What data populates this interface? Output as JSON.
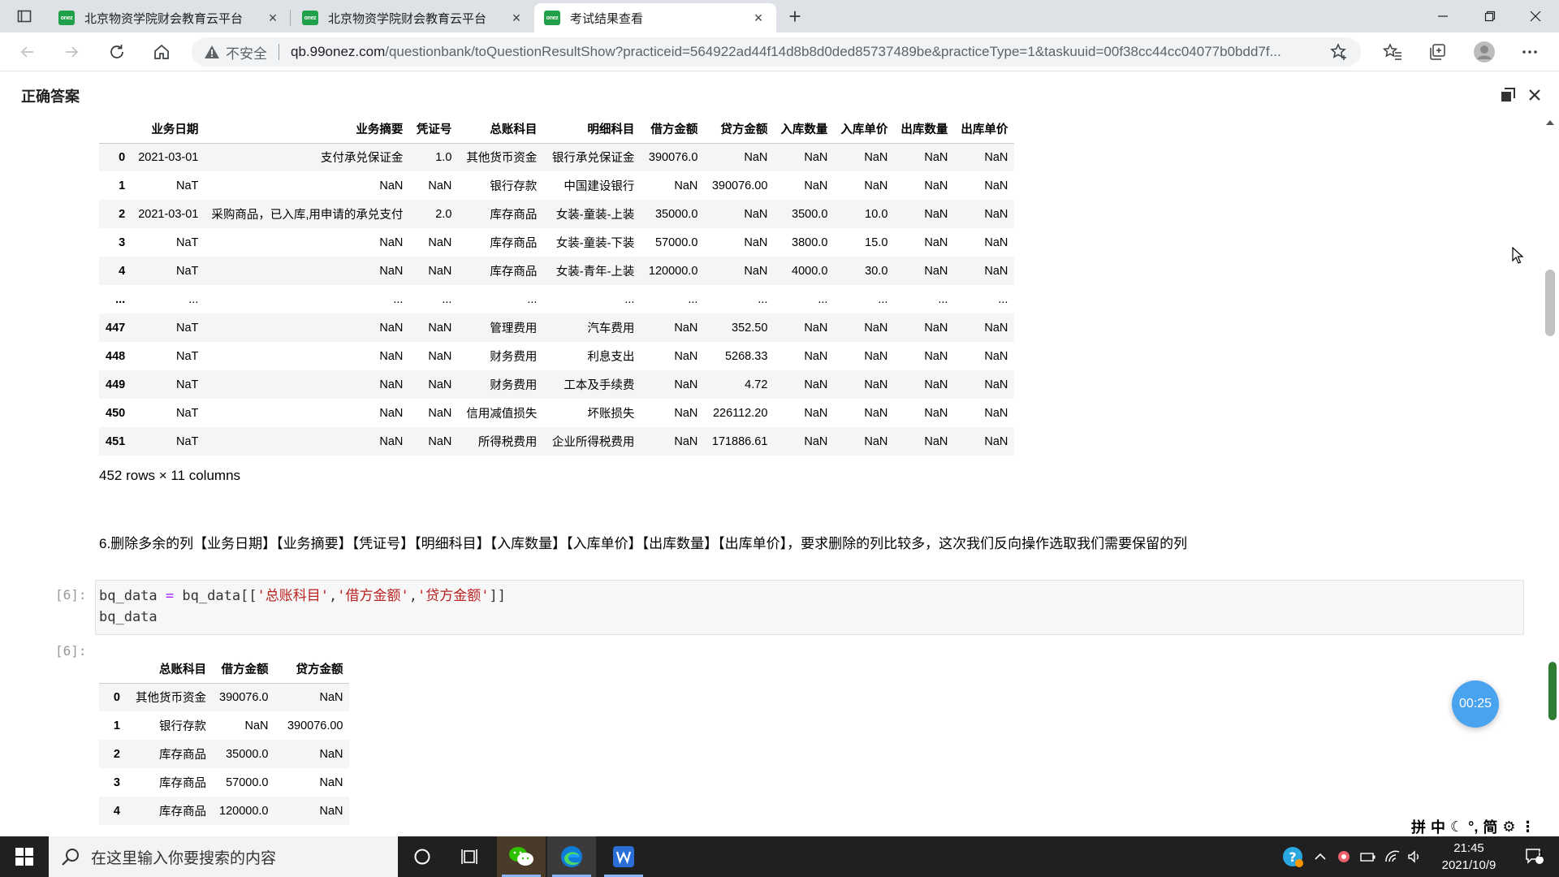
{
  "browser": {
    "tabs": [
      {
        "title": "北京物资学院财会教育云平台",
        "favicon_text": "onez"
      },
      {
        "title": "北京物资学院财会教育云平台",
        "favicon_text": "onez"
      },
      {
        "title": "考试结果查看",
        "favicon_text": "onez"
      }
    ],
    "address": {
      "security_label": "不安全",
      "host": "qb.99onez.com",
      "path": "/questionbank/toQuestionResultShow?practiceid=564922ad44f14d8b8d0ded85737489be&practiceType=1&taskuuid=00f38cc44cc04077b0bdd7f..."
    }
  },
  "panel": {
    "title": "正确答案"
  },
  "table1": {
    "columns": [
      "",
      "业务日期",
      "业务摘要",
      "凭证号",
      "总账科目",
      "明细科目",
      "借方金额",
      "贷方金额",
      "入库数量",
      "入库单价",
      "出库数量",
      "出库单价"
    ],
    "rows": [
      [
        "0",
        "2021-03-01",
        "支付承兑保证金",
        "1.0",
        "其他货币资金",
        "银行承兑保证金",
        "390076.0",
        "NaN",
        "NaN",
        "NaN",
        "NaN",
        "NaN"
      ],
      [
        "1",
        "NaT",
        "NaN",
        "NaN",
        "银行存款",
        "中国建设银行",
        "NaN",
        "390076.00",
        "NaN",
        "NaN",
        "NaN",
        "NaN"
      ],
      [
        "2",
        "2021-03-01",
        "采购商品，已入库,用申请的承兑支付",
        "2.0",
        "库存商品",
        "女装-童装-上装",
        "35000.0",
        "NaN",
        "3500.0",
        "10.0",
        "NaN",
        "NaN"
      ],
      [
        "3",
        "NaT",
        "NaN",
        "NaN",
        "库存商品",
        "女装-童装-下装",
        "57000.0",
        "NaN",
        "3800.0",
        "15.0",
        "NaN",
        "NaN"
      ],
      [
        "4",
        "NaT",
        "NaN",
        "NaN",
        "库存商品",
        "女装-青年-上装",
        "120000.0",
        "NaN",
        "4000.0",
        "30.0",
        "NaN",
        "NaN"
      ],
      [
        "...",
        "...",
        "...",
        "...",
        "...",
        "...",
        "...",
        "...",
        "...",
        "...",
        "...",
        "..."
      ],
      [
        "447",
        "NaT",
        "NaN",
        "NaN",
        "管理费用",
        "汽车费用",
        "NaN",
        "352.50",
        "NaN",
        "NaN",
        "NaN",
        "NaN"
      ],
      [
        "448",
        "NaT",
        "NaN",
        "NaN",
        "财务费用",
        "利息支出",
        "NaN",
        "5268.33",
        "NaN",
        "NaN",
        "NaN",
        "NaN"
      ],
      [
        "449",
        "NaT",
        "NaN",
        "NaN",
        "财务费用",
        "工本及手续费",
        "NaN",
        "4.72",
        "NaN",
        "NaN",
        "NaN",
        "NaN"
      ],
      [
        "450",
        "NaT",
        "NaN",
        "NaN",
        "信用减值损失",
        "坏账损失",
        "NaN",
        "226112.20",
        "NaN",
        "NaN",
        "NaN",
        "NaN"
      ],
      [
        "451",
        "NaT",
        "NaN",
        "NaN",
        "所得税费用",
        "企业所得税费用",
        "NaN",
        "171886.61",
        "NaN",
        "NaN",
        "NaN",
        "NaN"
      ]
    ],
    "shape_text": "452 rows × 11 columns"
  },
  "markdown": {
    "step6": "6.删除多余的列【业务日期】【业务摘要】【凭证号】【明细科目】【入库数量】【入库单价】【出库数量】【出库单价】，要求删除的列比较多，这次我们反向操作选取我们需要保留的列"
  },
  "cell6": {
    "in_prompt": "[6]:",
    "out_prompt": "[6]:",
    "code_line1_var": "bq_data",
    "code_line1_eq": "=",
    "code_line1_pre": "bq_data[[",
    "code_line1_s1": "'总账科目'",
    "code_line1_s2": "'借方金额'",
    "code_line1_s3": "'贷方金额'",
    "code_line1_post": "]]",
    "comma": ",",
    "code_line2": "bq_data"
  },
  "table2": {
    "columns": [
      "",
      "总账科目",
      "借方金额",
      "贷方金额"
    ],
    "rows": [
      [
        "0",
        "其他货币资金",
        "390076.0",
        "NaN"
      ],
      [
        "1",
        "银行存款",
        "NaN",
        "390076.00"
      ],
      [
        "2",
        "库存商品",
        "35000.0",
        "NaN"
      ],
      [
        "3",
        "库存商品",
        "57000.0",
        "NaN"
      ],
      [
        "4",
        "库存商品",
        "120000.0",
        "NaN"
      ]
    ]
  },
  "timer": {
    "text": "00:25",
    "color": "#4aa3ef"
  },
  "ime": {
    "items": [
      "拼",
      "中",
      "简"
    ]
  },
  "taskbar": {
    "search_placeholder": "在这里输入你要搜索的内容",
    "time": "21:45",
    "date": "2021/10/9",
    "notification_count": "1"
  }
}
